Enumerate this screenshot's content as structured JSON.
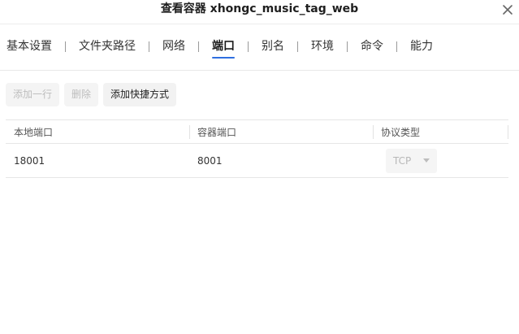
{
  "dialog": {
    "title": "查看容器 xhongc_music_tag_web",
    "close_icon": "close-icon"
  },
  "tabs": [
    {
      "label": "基本设置",
      "active": false
    },
    {
      "label": "文件夹路径",
      "active": false
    },
    {
      "label": "网络",
      "active": false
    },
    {
      "label": "端口",
      "active": true
    },
    {
      "label": "别名",
      "active": false
    },
    {
      "label": "环境",
      "active": false
    },
    {
      "label": "命令",
      "active": false
    },
    {
      "label": "能力",
      "active": false
    }
  ],
  "toolbar": {
    "add_row_label": "添加一行",
    "delete_label": "删除",
    "add_shortcut_label": "添加快捷方式"
  },
  "table": {
    "headers": [
      "本地端口",
      "容器端口",
      "协议类型"
    ],
    "rows": [
      {
        "local_port": "18001",
        "container_port": "8001",
        "protocol": "TCP"
      }
    ]
  },
  "colors": {
    "accent": "#2f6fe0",
    "disabled_text": "#bdbdbd"
  }
}
